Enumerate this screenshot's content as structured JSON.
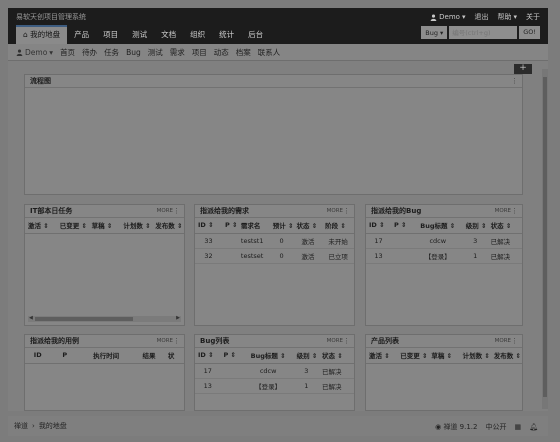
{
  "header": {
    "app_title": "易软天创项目管理系统",
    "user": "Demo",
    "links": [
      "退出",
      "帮助",
      "关于"
    ],
    "tabs": [
      "我的地盘",
      "产品",
      "项目",
      "测试",
      "文档",
      "组织",
      "统计",
      "后台"
    ],
    "search": {
      "type": "Bug",
      "placeholder": "编号(ctrl+g)",
      "go": "GO!"
    }
  },
  "subnav": {
    "user": "Demo",
    "items": [
      "首页",
      "待办",
      "任务",
      "Bug",
      "测试",
      "需求",
      "项目",
      "动态",
      "档案",
      "联系人"
    ]
  },
  "add_button": "+",
  "panels": {
    "flowchart": {
      "title": "流程图"
    },
    "tasks": {
      "title": "IT部本日任务",
      "more": "MORE",
      "columns": [
        "激活",
        "已变更",
        "草稿",
        "计划数",
        "发布数"
      ]
    },
    "stories": {
      "title": "指派给我的需求",
      "more": "MORE",
      "columns": [
        "ID",
        "P",
        "需求名",
        "预计",
        "状态",
        "阶段"
      ],
      "rows": [
        [
          "33",
          "",
          "testst1",
          "0",
          "激活",
          "未开始"
        ],
        [
          "32",
          "",
          "testset",
          "0",
          "激活",
          "已立项"
        ]
      ]
    },
    "bugs": {
      "title": "指派给我的Bug",
      "more": "MORE",
      "columns": [
        "ID",
        "P",
        "Bug标题",
        "级别",
        "状态"
      ],
      "rows": [
        [
          "17",
          "",
          "cdcw",
          "3",
          "已解决"
        ],
        [
          "13",
          "",
          "【登录】",
          "1",
          "已解决"
        ]
      ]
    },
    "cases": {
      "title": "指派给我的用例",
      "more": "MORE",
      "columns": [
        "ID",
        "P",
        "执行时间",
        "结果",
        "状"
      ]
    },
    "bug_list": {
      "title": "Bug列表",
      "more": "MORE",
      "columns": [
        "ID",
        "P",
        "Bug标题",
        "级别",
        "状态"
      ],
      "rows": [
        [
          "17",
          "",
          "cdcw",
          "3",
          "已解决"
        ],
        [
          "13",
          "",
          "【登录】",
          "1",
          "已解决"
        ]
      ]
    },
    "products": {
      "title": "产品列表",
      "more": "MORE",
      "columns": [
        "激活",
        "已变更",
        "草稿",
        "计划数",
        "发布数"
      ]
    }
  },
  "footer": {
    "breadcrumb": [
      "禅道",
      "我的地盘"
    ],
    "version": "禅道 9.1.2",
    "lang": "中公开"
  }
}
